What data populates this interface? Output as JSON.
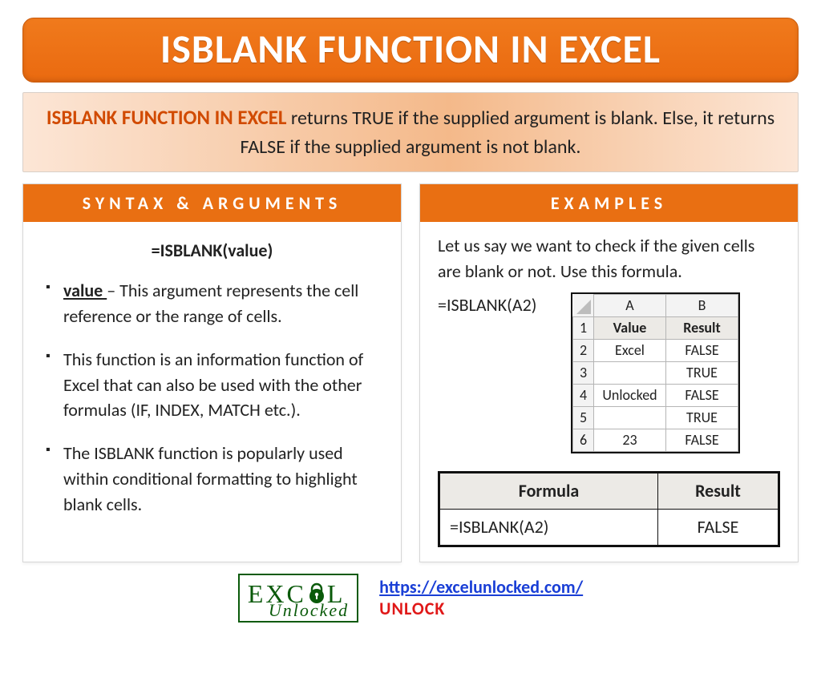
{
  "title": "ISBLANK FUNCTION IN EXCEL",
  "description": {
    "lead": "ISBLANK FUNCTION IN EXCEL",
    "rest": " returns TRUE if the supplied argument is blank. Else, it returns FALSE if the supplied argument is not blank."
  },
  "syntax_panel": {
    "header": "SYNTAX & ARGUMENTS",
    "formula": "=ISBLANK(value)",
    "arg_name": "value ",
    "arg_desc": "– This argument represents the cell reference or the range of cells.",
    "point2": "This function is an information function of Excel that can also be used with the other formulas (IF, INDEX, MATCH etc.).",
    "point3": "The ISBLANK function is popularly used within conditional formatting to highlight blank cells."
  },
  "examples_panel": {
    "header": "EXAMPLES",
    "intro": "Let us say we want to check if the given cells are blank or not. Use this formula.",
    "formula": "=ISBLANK(A2)",
    "sheet": {
      "colA": "A",
      "colB": "B",
      "headA": "Value",
      "headB": "Result",
      "rows": [
        {
          "n": "1"
        },
        {
          "n": "2",
          "a": "Excel",
          "b": "FALSE"
        },
        {
          "n": "3",
          "a": "",
          "b": "TRUE"
        },
        {
          "n": "4",
          "a": "Unlocked",
          "b": "FALSE"
        },
        {
          "n": "5",
          "a": "",
          "b": "TRUE"
        },
        {
          "n": "6",
          "a": "23",
          "b": "FALSE"
        }
      ]
    },
    "result_table": {
      "h1": "Formula",
      "h2": "Result",
      "formula": "=ISBLANK(A2)",
      "result": "FALSE"
    }
  },
  "footer": {
    "logo_top": "EXCEL",
    "logo_bottom": "Unlocked",
    "url": "https://excelunlocked.com/",
    "unlock": "UNLOCK"
  }
}
